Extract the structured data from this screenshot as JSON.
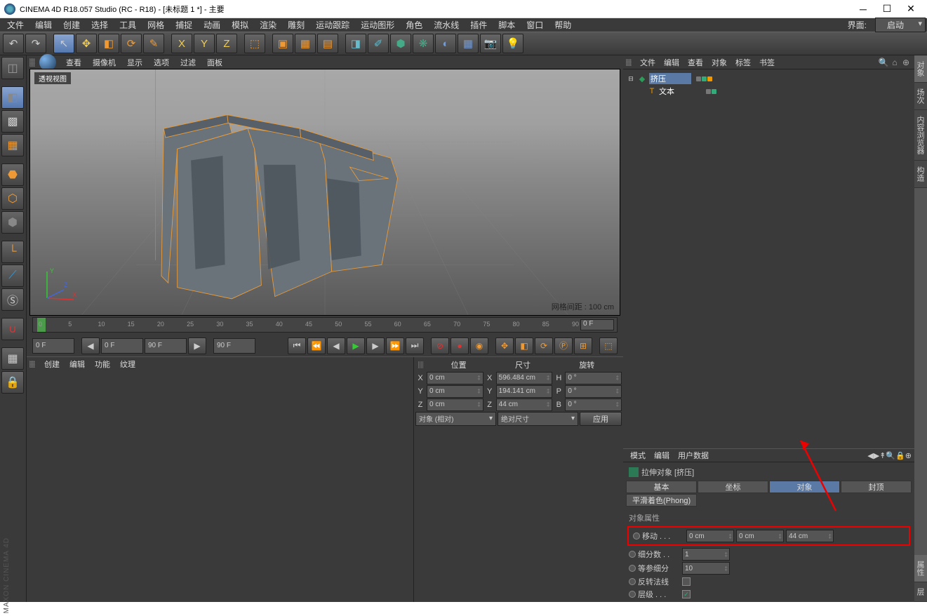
{
  "title": "CINEMA 4D R18.057 Studio (RC - R18) - [未标题 1 *] - 主要",
  "layoutbar": {
    "label": "界面:",
    "value": "启动"
  },
  "menu": [
    "文件",
    "编辑",
    "创建",
    "选择",
    "工具",
    "网格",
    "捕捉",
    "动画",
    "模拟",
    "渲染",
    "雕刻",
    "运动跟踪",
    "运动图形",
    "角色",
    "流水线",
    "插件",
    "脚本",
    "窗口",
    "帮助"
  ],
  "viewportMenu": [
    "查看",
    "摄像机",
    "显示",
    "选项",
    "过滤",
    "面板"
  ],
  "viewportLabel": "透视视图",
  "gridStatus": "网格间距 : 100 cm",
  "axes": {
    "x": "X",
    "y": "Y",
    "z": "Z"
  },
  "timeline": {
    "start": "0",
    "end": "90",
    "endField": "0 F",
    "f1": "0 F",
    "f2": "0 F",
    "f3": "90 F",
    "f4": "90 F",
    "ticks": [
      "0",
      "5",
      "10",
      "15",
      "20",
      "25",
      "30",
      "35",
      "40",
      "45",
      "50",
      "55",
      "60",
      "65",
      "70",
      "75",
      "80",
      "85",
      "90"
    ]
  },
  "materialMenu": [
    "创建",
    "编辑",
    "功能",
    "纹理"
  ],
  "coord": {
    "headers": [
      "位置",
      "尺寸",
      "旋转"
    ],
    "rows": [
      {
        "l": "X",
        "p": "0 cm",
        "s": "596.484 cm",
        "rl": "H",
        "r": "0 °"
      },
      {
        "l": "Y",
        "p": "0 cm",
        "s": "194.141 cm",
        "rl": "P",
        "r": "0 °"
      },
      {
        "l": "Z",
        "p": "0 cm",
        "s": "44 cm",
        "rl": "B",
        "r": "0 °"
      }
    ],
    "mode1": "对象 (相对)",
    "mode2": "绝对尺寸",
    "apply": "应用"
  },
  "objPanel": {
    "menu": [
      "文件",
      "编辑",
      "查看",
      "对象",
      "标签",
      "书签"
    ],
    "tree": [
      {
        "indent": 0,
        "twisty": "⊟",
        "icon": "◆",
        "iconColor": "#2c9b5a",
        "name": "挤压",
        "sel": true,
        "tags": [
          {
            "c": "#777"
          },
          {
            "c": "#3a7",
            "chk": true
          },
          {
            "c": "#e90",
            "dot": true
          }
        ]
      },
      {
        "indent": 1,
        "twisty": "",
        "icon": "T",
        "iconColor": "#e90",
        "name": "文本",
        "sel": false,
        "tags": [
          {
            "c": "#777"
          },
          {
            "c": "#3a7",
            "chk": true
          }
        ]
      }
    ]
  },
  "rightTabs": [
    "对象",
    "场次",
    "内容浏览器",
    "构造"
  ],
  "rightTabs2": [
    "属性",
    "层"
  ],
  "attrMenu": [
    "模式",
    "编辑",
    "用户数据"
  ],
  "attr": {
    "title": "拉伸对象 [挤压]",
    "tabs": [
      "基本",
      "坐标",
      "对象",
      "封顶"
    ],
    "phong": "平滑着色(Phong)",
    "section": "对象属性",
    "props": {
      "moveLabel": "移动 . . .",
      "move": [
        "0 cm",
        "0 cm",
        "44 cm"
      ],
      "segLabel": "细分数 . .",
      "seg": "1",
      "isoLabel": "等参细分",
      "iso": "10",
      "flipLabel": "反转法线",
      "hierLabel": "层级 . . ."
    }
  }
}
